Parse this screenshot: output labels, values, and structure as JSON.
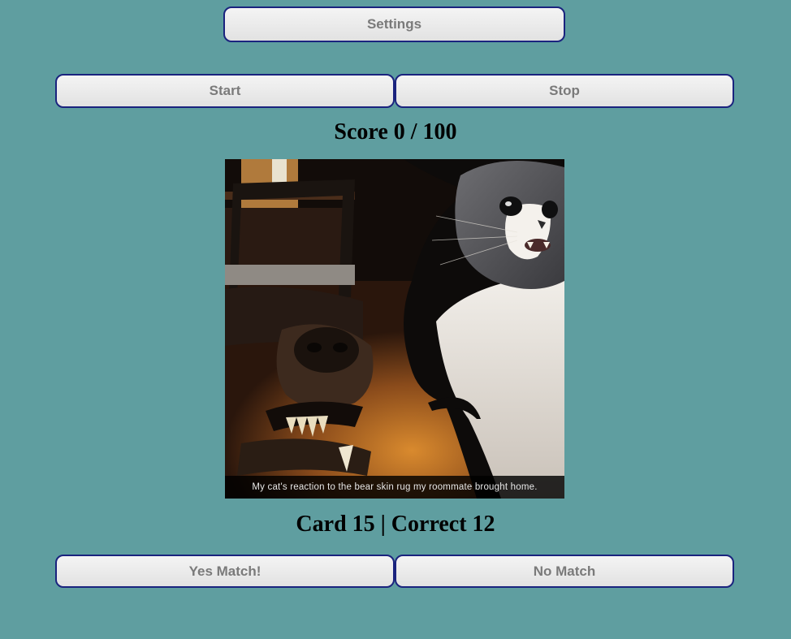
{
  "controls": {
    "settings_label": "Settings",
    "start_label": "Start",
    "stop_label": "Stop",
    "yes_label": "Yes Match!",
    "no_label": "No Match"
  },
  "score": {
    "text": "Score 0 / 100"
  },
  "card": {
    "caption": "My cat's reaction to the bear skin rug my roommate brought home.",
    "status_text": "Card 15 | Correct 12"
  },
  "colors": {
    "background": "#5f9ea0",
    "button_border": "#1a237e",
    "button_text": "#7a7a7a"
  }
}
